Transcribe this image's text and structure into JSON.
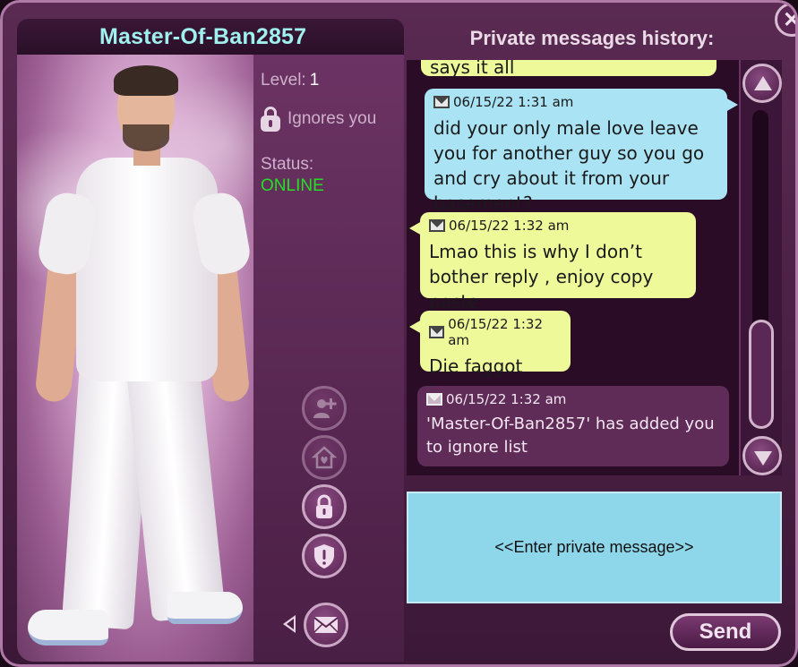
{
  "profile": {
    "username": "Master-Of-Ban2857",
    "level_label": "Level:",
    "level_value": "1",
    "ignore_text": "Ignores you",
    "status_label": "Status:",
    "status_value": "ONLINE"
  },
  "icons": {
    "add_friend": "add-friend-icon",
    "home": "home-icon",
    "lock": "lock-icon",
    "shield": "shield-icon",
    "message": "envelope-icon",
    "close": "close-icon"
  },
  "history": {
    "title": "Private messages history:",
    "messages": [
      {
        "meta": "",
        "text": "says it all",
        "style": "yellow"
      },
      {
        "meta": "06/15/22  1:31 am",
        "text": "did your only male love leave you for another guy so you go and cry about it from your basement?",
        "style": "blue"
      },
      {
        "meta": "06/15/22  1:32 am",
        "text": "Lmao this is why I don’t bother reply , enjoy copy paste",
        "style": "yellow"
      },
      {
        "meta": "06/15/22  1:32 am",
        "text": "Die faggot loser",
        "style": "yellow"
      },
      {
        "meta": "06/15/22  1:32 am",
        "text": "'Master-Of-Ban2857' has added you to ignore list",
        "style": "system"
      }
    ]
  },
  "input": {
    "placeholder": "<<Enter private message>>"
  },
  "send_label": "Send",
  "colors": {
    "name": "#9ff0ee",
    "online": "#22e022",
    "bubble_blue": "#a9e3f4",
    "bubble_yellow": "#eef99a",
    "input_bg": "#8ed6ea"
  }
}
